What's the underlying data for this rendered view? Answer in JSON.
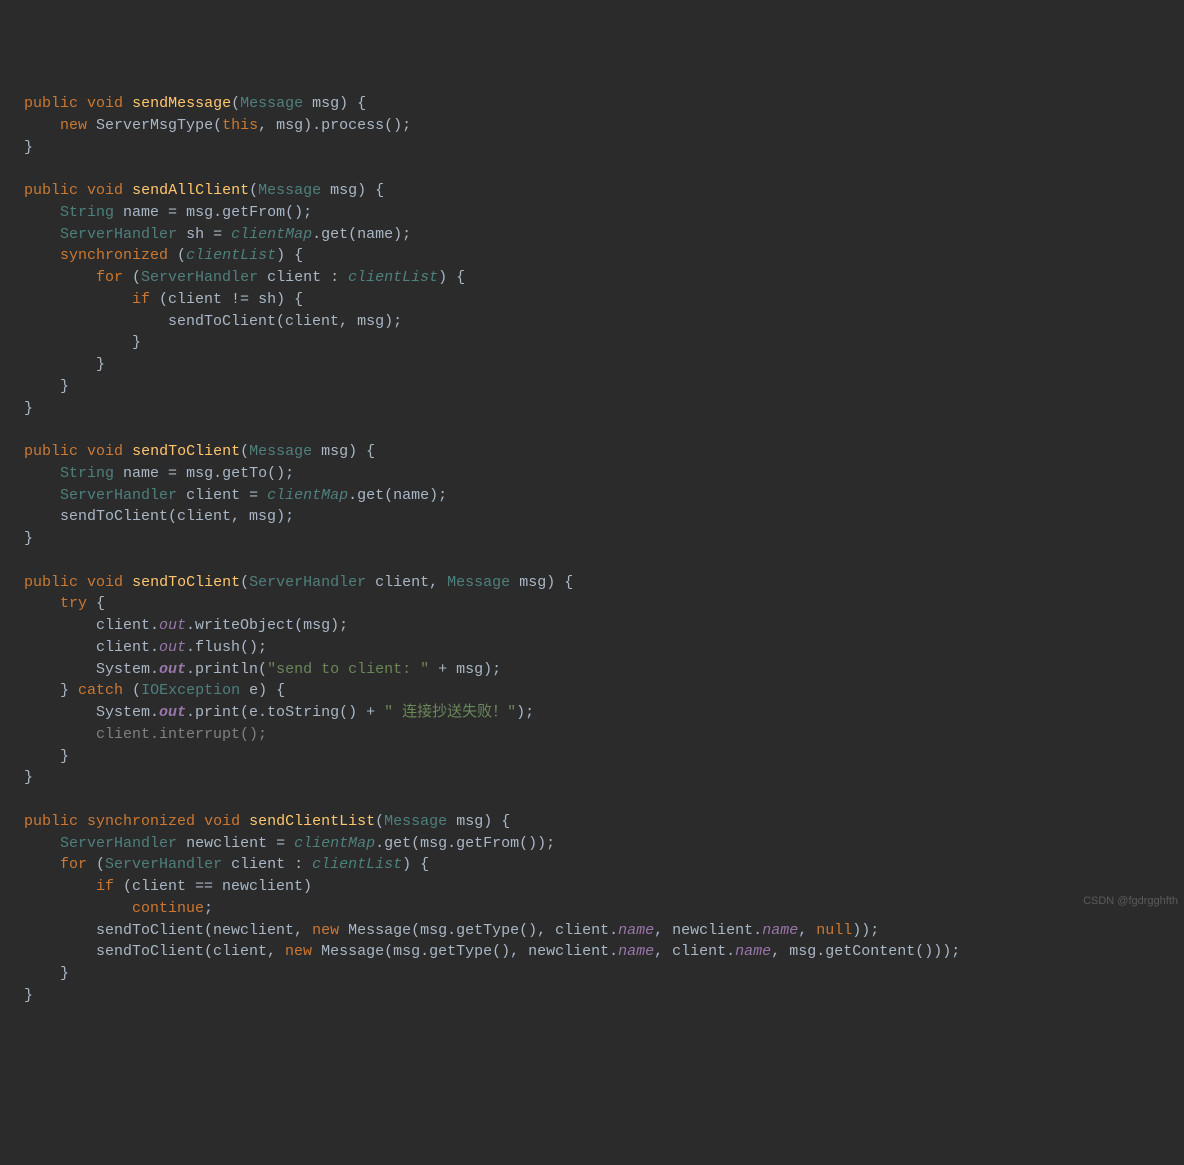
{
  "watermark": "CSDN @fgdrgghfth",
  "code": {
    "m1_sig_1": "public",
    "m1_sig_2": "void",
    "m1_sig_3": "sendMessage",
    "m1_sig_4": "Message",
    "m1_sig_5": "msg",
    "m1_l1_1": "new",
    "m1_l1_2": "ServerMsgType",
    "m1_l1_3": "this",
    "m1_l1_4": "msg",
    "m1_l1_5": ".process();",
    "m2_sig_1": "public",
    "m2_sig_2": "void",
    "m2_sig_3": "sendAllClient",
    "m2_sig_4": "Message",
    "m2_sig_5": "msg",
    "m2_l1_1": "String",
    "m2_l1_2": "name = ",
    "m2_l1_3": "msg",
    "m2_l1_4": ".getFrom();",
    "m2_l2_1": "ServerHandler",
    "m2_l2_2": "sh = ",
    "m2_l2_3": "clientMap",
    "m2_l2_4": ".get(",
    "m2_l2_5": "name",
    "m2_l2_6": ");",
    "m2_l3_1": "synchronized",
    "m2_l3_2": " (",
    "m2_l3_3": "clientList",
    "m2_l3_4": ") {",
    "m2_l4_1": "for",
    "m2_l4_2": " (",
    "m2_l4_3": "ServerHandler",
    "m2_l4_4": " client : ",
    "m2_l4_5": "clientList",
    "m2_l4_6": ") {",
    "m2_l5_1": "if",
    "m2_l5_2": " (client != sh) {",
    "m2_l6_1": "sendToClient(client, ",
    "m2_l6_2": "msg",
    "m2_l6_3": ");",
    "m3_sig_1": "public",
    "m3_sig_2": "void",
    "m3_sig_3": "sendToClient",
    "m3_sig_4": "Message",
    "m3_sig_5": "msg",
    "m3_l1_1": "String",
    "m3_l1_2": "name = ",
    "m3_l1_3": "msg",
    "m3_l1_4": ".getTo();",
    "m3_l2_1": "ServerHandler",
    "m3_l2_2": "client = ",
    "m3_l2_3": "clientMap",
    "m3_l2_4": ".get(",
    "m3_l2_5": "name",
    "m3_l2_6": ");",
    "m3_l3_1": "sendToClient(client, ",
    "m3_l3_2": "msg",
    "m3_l3_3": ");",
    "m4_sig_1": "public",
    "m4_sig_2": "void",
    "m4_sig_3": "sendToClient",
    "m4_sig_4": "ServerHandler",
    "m4_sig_5": "client, ",
    "m4_sig_6": "Message",
    "m4_sig_7": "msg",
    "m4_l1_1": "try",
    "m4_l1_2": " {",
    "m4_l2_1": "client.",
    "m4_l2_2": "out",
    "m4_l2_3": ".writeObject(",
    "m4_l2_4": "msg",
    "m4_l2_5": ");",
    "m4_l3_1": "client.",
    "m4_l3_2": "out",
    "m4_l3_3": ".flush();",
    "m4_l4_1": "System.",
    "m4_l4_2": "out",
    "m4_l4_3": ".println(",
    "m4_l4_4": "\"send to client: \"",
    "m4_l4_5": " + ",
    "m4_l4_6": "msg",
    "m4_l4_7": ");",
    "m4_l5_1": "} ",
    "m4_l5_2": "catch",
    "m4_l5_3": " (",
    "m4_l5_4": "IOException",
    "m4_l5_5": " e) {",
    "m4_l6_1": "System.",
    "m4_l6_2": "out",
    "m4_l6_3": ".print(e.toString() + ",
    "m4_l6_4": "\" 连接抄送失败！\"",
    "m4_l6_5": ");",
    "m4_l7_1": "client.interrupt();",
    "m5_sig_1": "public",
    "m5_sig_2": "synchronized",
    "m5_sig_3": "void",
    "m5_sig_4": "sendClientList",
    "m5_sig_5": "Message",
    "m5_sig_6": "msg",
    "m5_l1_1": "ServerHandler",
    "m5_l1_2": "newclient = ",
    "m5_l1_3": "clientMap",
    "m5_l1_4": ".get(",
    "m5_l1_5": "msg",
    "m5_l1_6": ".getFrom());",
    "m5_l2_1": "for",
    "m5_l2_2": " (",
    "m5_l2_3": "ServerHandler",
    "m5_l2_4": " client : ",
    "m5_l2_5": "clientList",
    "m5_l2_6": ") {",
    "m5_l3_1": "if",
    "m5_l3_2": " (client == newclient)",
    "m5_l4_1": "continue",
    "m5_l4_2": ";",
    "m5_l5_1": "sendToClient(newclient, ",
    "m5_l5_2": "new",
    "m5_l5_3": " Message(",
    "m5_l5_4": "msg",
    "m5_l5_5": ".getType(), client.",
    "m5_l5_6": "name",
    "m5_l5_7": ", newclient.",
    "m5_l5_8": "name",
    "m5_l5_9": ", ",
    "m5_l5_10": "null",
    "m5_l5_11": "));",
    "m5_l6_1": "sendToClient(client, ",
    "m5_l6_2": "new",
    "m5_l6_3": " Message(",
    "m5_l6_4": "msg",
    "m5_l6_5": ".getType(), newclient.",
    "m5_l6_6": "name",
    "m5_l6_7": ", client.",
    "m5_l6_8": "name",
    "m5_l6_9": ", ",
    "m5_l6_10": "msg",
    "m5_l6_11": ".getContent()));"
  }
}
